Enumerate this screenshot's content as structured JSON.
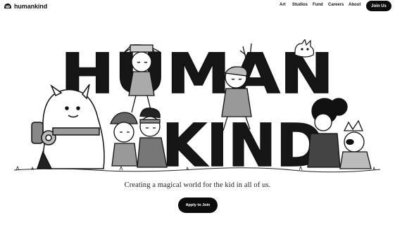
{
  "brand": {
    "name": "humankind"
  },
  "nav": {
    "links": [
      "Art",
      "Studios",
      "Fund",
      "Careers",
      "About"
    ],
    "cta_label": "Join Us"
  },
  "hero": {
    "wordmark_line1": "HUMAN",
    "wordmark_line2": "KIND",
    "tagline": "Creating a magical world for the kid in all of us.",
    "cta_label": "Apply to Join"
  },
  "colors": {
    "ink": "#111111",
    "button": "#0c0c0c",
    "background": "#ffffff"
  },
  "icons": [
    "brand-logo-icon"
  ]
}
